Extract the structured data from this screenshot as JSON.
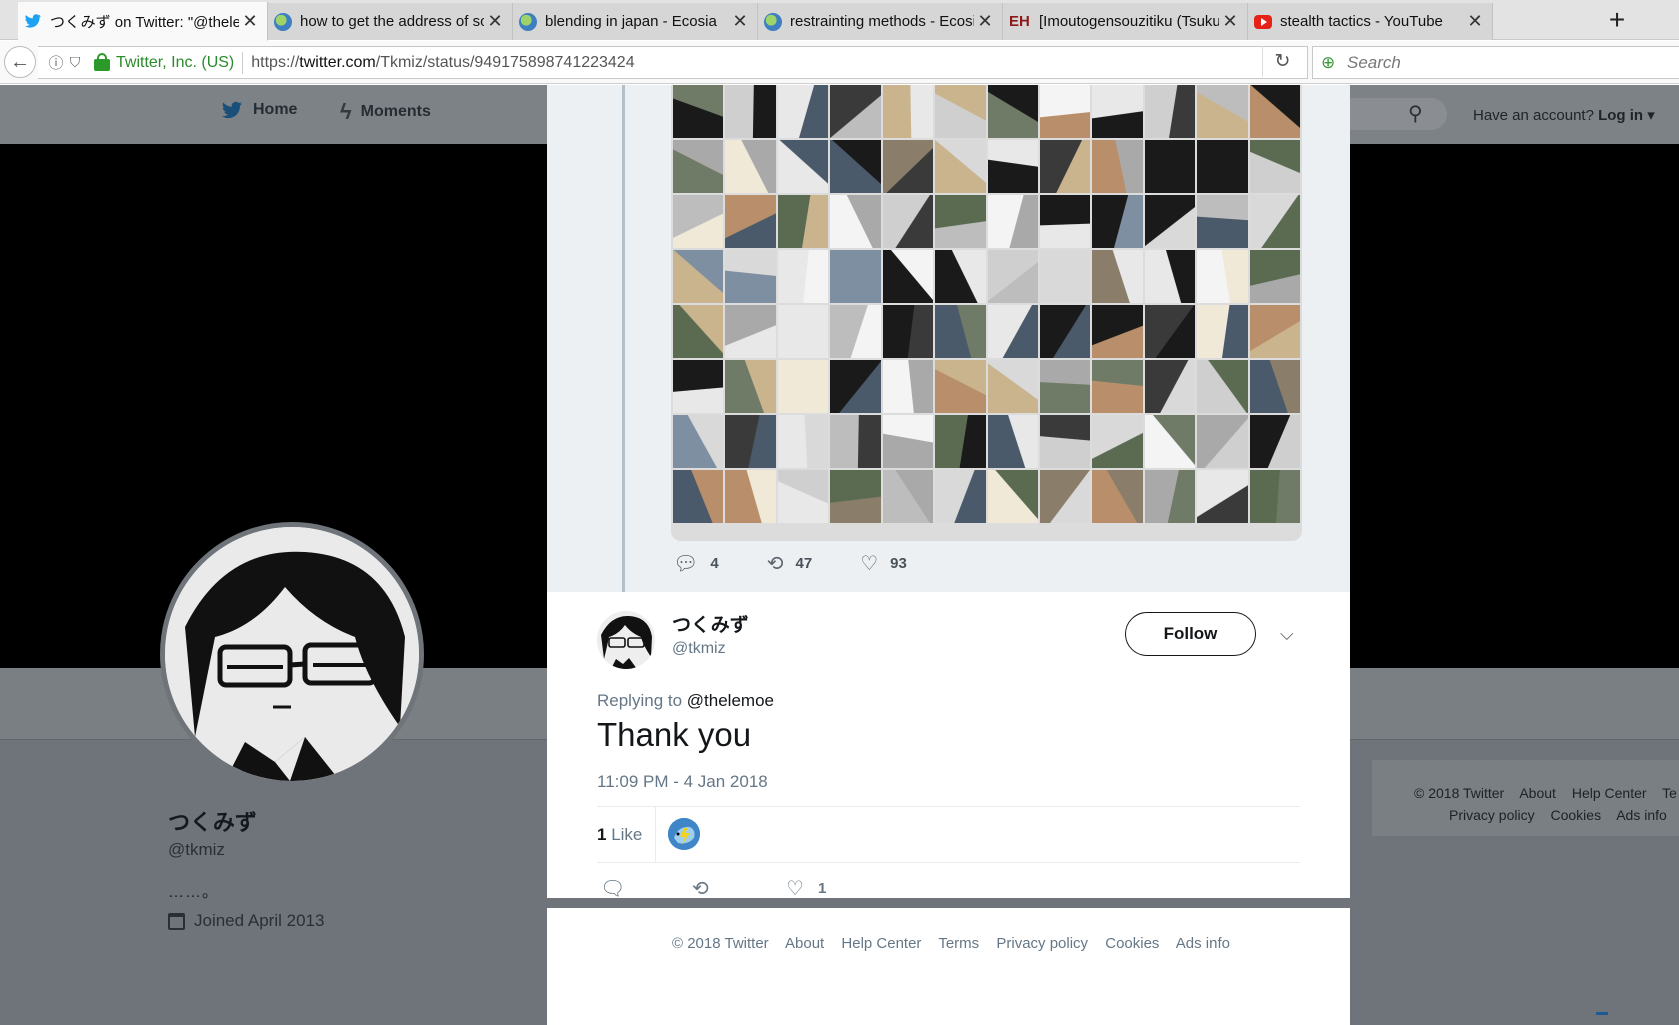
{
  "browser": {
    "tabs": [
      {
        "title": "つくみず on Twitter: \"@thele",
        "favicon": "twitter-icon",
        "active": true,
        "color": "#1da1f2"
      },
      {
        "title": "how to get the address of so",
        "favicon": "ecosia-icon",
        "active": false,
        "color": "#5a9b4a"
      },
      {
        "title": "blending in japan - Ecosia",
        "favicon": "ecosia-icon",
        "active": false,
        "color": "#5a9b4a"
      },
      {
        "title": "restrainting methods - Ecosia",
        "favicon": "ecosia-icon",
        "active": false,
        "color": "#5a9b4a"
      },
      {
        "title": "[Imoutogensouzitiku (Tsukun",
        "favicon": "eh-icon",
        "active": false,
        "color": "#8b1a1a"
      },
      {
        "title": "stealth tactics - YouTube",
        "favicon": "youtube-icon",
        "active": false,
        "color": "#e62117"
      }
    ],
    "identity": "Twitter, Inc. (US)",
    "url_prefix": "https://",
    "url_host": "twitter.com",
    "url_path": "/Tkmiz/status/949175898741223424",
    "search_placeholder": "Search"
  },
  "twitter_nav": {
    "home": "Home",
    "moments": "Moments",
    "account_prefix": "Have an account?",
    "login": "Log in"
  },
  "profile": {
    "name": "つくみず",
    "handle": "@tkmiz",
    "bio": "……。",
    "joined": "Joined April 2013"
  },
  "parent_tweet": {
    "replies": "4",
    "retweets": "47",
    "likes": "93"
  },
  "tweet": {
    "name": "つくみず",
    "handle": "@tkmiz",
    "follow_label": "Follow",
    "replying_prefix": "Replying to",
    "replying_to": "@thelemoe",
    "text": "Thank you",
    "timestamp": "11:09 PM - 4 Jan 2018",
    "like_count": "1",
    "like_label": "Like",
    "action_like_count": "1"
  },
  "side_footer": {
    "row1": [
      "© 2018 Twitter",
      "About",
      "Help Center",
      "Te"
    ],
    "row2": [
      "Privacy policy",
      "Cookies",
      "Ads info"
    ]
  },
  "footer": {
    "links": [
      "© 2018 Twitter",
      "About",
      "Help Center",
      "Terms",
      "Privacy policy",
      "Cookies",
      "Ads info"
    ]
  },
  "colors": {
    "twitter_blue": "#1da1f2",
    "secure_green": "#2b8a2b"
  }
}
